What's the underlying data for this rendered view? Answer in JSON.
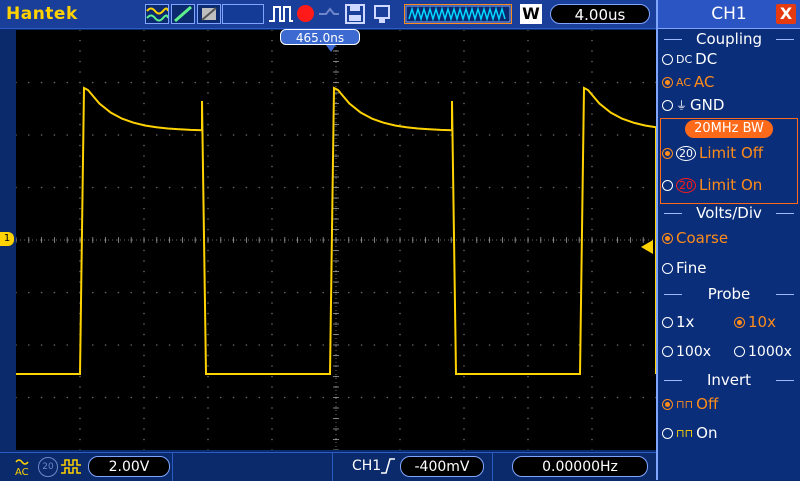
{
  "topbar": {
    "brand": "Hantek",
    "icons": [
      "waveform-mode-icon",
      "edge-slope-icon",
      "persistence-icon",
      "blank-slot",
      "pulse-icon",
      "record-icon",
      "dim-icon",
      "save-icon",
      "usb-icon"
    ],
    "timebase": "4.00us",
    "window_button": "W"
  },
  "trigger_position": "465.0ns",
  "channel_marker": "1",
  "bottombar": {
    "coupling_icon": "AC",
    "bw_icon": "20",
    "volts_div": "2.00V",
    "trigger_source": "CH1",
    "trigger_level": "-400mV",
    "frequency": "0.00000Hz"
  },
  "panel": {
    "title": "CH1",
    "close": "X",
    "coupling": {
      "title": "Coupling",
      "options": [
        {
          "icon": "DC",
          "label": "DC",
          "selected": false
        },
        {
          "icon": "AC",
          "label": "AC",
          "selected": true
        },
        {
          "icon": "GND",
          "label": "GND",
          "selected": false
        }
      ]
    },
    "bandwidth": {
      "title": "20MHz BW",
      "options": [
        {
          "icon": "20",
          "label": "Limit Off",
          "selected": true
        },
        {
          "icon": "20",
          "label": "Limit On",
          "selected": false
        }
      ]
    },
    "volts_div": {
      "title": "Volts/Div",
      "options": [
        {
          "label": "Coarse",
          "selected": true
        },
        {
          "label": "Fine",
          "selected": false
        }
      ]
    },
    "probe": {
      "title": "Probe",
      "options": [
        {
          "label": "1x",
          "selected": false
        },
        {
          "label": "10x",
          "selected": true
        },
        {
          "label": "100x",
          "selected": false
        },
        {
          "label": "1000x",
          "selected": false
        }
      ]
    },
    "invert": {
      "title": "Invert",
      "options": [
        {
          "label": "Off",
          "selected": true
        },
        {
          "label": "On",
          "selected": false
        }
      ]
    }
  },
  "colors": {
    "trace": "#ffd200",
    "accent": "#ff8c1a",
    "panel_bg": "#0b2e7a",
    "screen_bg": "#000000"
  }
}
